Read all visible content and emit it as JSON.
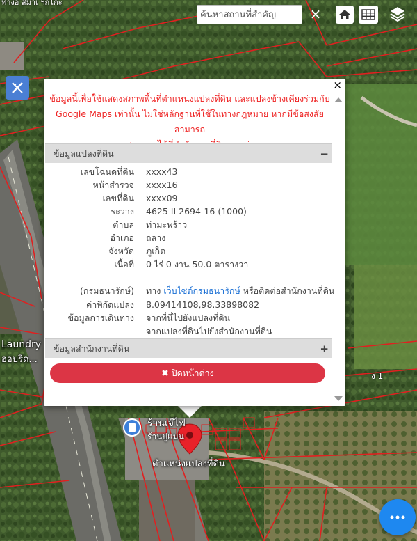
{
  "search": {
    "placeholder": "ค้นหาสถานที่สำคัญ",
    "clear_label": "×"
  },
  "map_labels": {
    "top_left": "ทางอ สมาเ ฯกโกะ",
    "laundry_1": "Laundry",
    "laundry_2": "ฮอบรีด...",
    "road_sign": "ง 1",
    "place_1": "ร้านเจ๊ไฟ",
    "place_2": "ร้านปูแมน",
    "marker_caption": "ตำแหน่งแปลงที่ดิน"
  },
  "colors": {
    "parcel_line": "#e02020",
    "accent": "#dc3545",
    "link": "#1a6fd4",
    "fab": "#1e88f0"
  },
  "popup": {
    "disclaimer_lines": [
      "ข้อมูลนี้เพื่อใช้แสดงสภาพพื้นที่ตำแหน่งแปลงที่ดิน และแปลงข้างเคียงร่วมกับ",
      "Google Maps เท่านั้น ไม่ใช่หลักฐานที่ใช้ในทางกฎหมาย หากมีข้อสงสัยสามารถ",
      "สอบถามได้ที่สำนักงานที่ดินทุกแห่ง"
    ],
    "parcel_section": {
      "title": "ข้อมูลแปลงที่ดิน",
      "toggle": "−",
      "rows": [
        {
          "k": "เลขโฉนดที่ดิน",
          "v": "xxxx43"
        },
        {
          "k": "หน้าสำรวจ",
          "v": "xxxx16"
        },
        {
          "k": "เลขที่ดิน",
          "v": "xxxx09"
        },
        {
          "k": "ระวาง",
          "v": "4625 II 2694-16 (1000)"
        },
        {
          "k": "ตำบล",
          "v": "ท่ามะพร้าว"
        },
        {
          "k": "อำเภอ",
          "v": "ถลาง"
        },
        {
          "k": "จังหวัด",
          "v": "ภูเก็ต"
        },
        {
          "k": "เนื้อที่",
          "v": "0 ไร่ 0 งาน 50.0 ตารางวา"
        }
      ],
      "price_key": "(กรมธนารักษ์)",
      "price_prefix": "ทาง",
      "price_link": "เว็บไซต์กรมธนารักษ์",
      "price_suffix": "หรือติดต่อสำนักงานที่ดิน",
      "coord_key": "ค่าพิกัดแปลง",
      "coord_value": "8.09414108,98.33898082",
      "travel_key": "ข้อมูลการเดินทาง",
      "travel_link_1": "จากที่นี่ไปยังแปลงที่ดิน",
      "travel_link_2": "จากแปลงที่ดินไปยังสำนักงานที่ดิน"
    },
    "office_section": {
      "title": "ข้อมูลสำนักงานที่ดิน",
      "toggle": "+"
    },
    "close_window_label": "ปิดหน้าต่าง",
    "close_icon": "×"
  }
}
